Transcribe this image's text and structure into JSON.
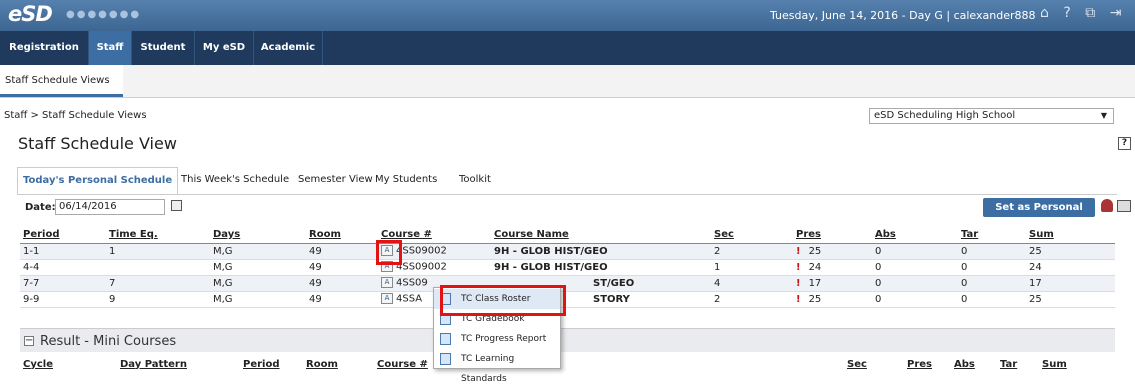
{
  "header": {
    "logo": "eSD",
    "dots": "●●●●●●●",
    "date_user": "Tuesday, June 14, 2016 - Day G  |  calexander888",
    "icons": [
      "home-icon",
      "help-icon",
      "window-icon",
      "logout-icon"
    ]
  },
  "nav": {
    "items": [
      "Registration",
      "Staff",
      "Student",
      "My eSD",
      "Academic"
    ],
    "active": "Staff"
  },
  "subnav": {
    "label": "Staff Schedule Views"
  },
  "breadcrumb": "Staff > Staff Schedule Views",
  "school_select": "eSD Scheduling High School",
  "page_title": "Staff Schedule View",
  "tabs": [
    "Today's Personal Schedule",
    "This Week's Schedule",
    "Semester View",
    "My Students",
    "Toolkit"
  ],
  "date_label": "Date:",
  "date_value": "06/14/2016",
  "set_personal_button": "Set as Personal Page",
  "schedule": {
    "columns": [
      "Period",
      "Time Eq.",
      "Days",
      "Room",
      "Course #",
      "Course Name",
      "Sec",
      "Pres",
      "Abs",
      "Tar",
      "Sum"
    ],
    "rows": [
      {
        "period": "1-1",
        "time": "1",
        "days": "M,G",
        "room": "49",
        "course": "4SS09002",
        "name": "9H - GLOB HIST/GEO",
        "sec": "2",
        "pres": "25",
        "abs": "0",
        "tar": "0",
        "sum": "25"
      },
      {
        "period": "4-4",
        "time": "",
        "days": "M,G",
        "room": "49",
        "course": "4SS09002",
        "name": "9H - GLOB HIST/GEO",
        "sec": "1",
        "pres": "24",
        "abs": "0",
        "tar": "0",
        "sum": "24"
      },
      {
        "period": "7-7",
        "time": "7",
        "days": "M,G",
        "room": "49",
        "course": "4SS09",
        "name": "ST/GEO",
        "sec": "4",
        "pres": "17",
        "abs": "0",
        "tar": "0",
        "sum": "17"
      },
      {
        "period": "9-9",
        "time": "9",
        "days": "M,G",
        "room": "49",
        "course": "4SSA",
        "name": "STORY",
        "sec": "2",
        "pres": "25",
        "abs": "0",
        "tar": "0",
        "sum": "25"
      }
    ]
  },
  "mini_courses": {
    "title": "Result - Mini Courses",
    "toggle": "−",
    "columns": [
      "Cycle",
      "Day Pattern",
      "Period",
      "Room",
      "Course #",
      "Sec",
      "Pres",
      "Abs",
      "Tar",
      "Sum"
    ]
  },
  "context_menu": {
    "items": [
      "TC Class Roster",
      "TC Gradebook",
      "TC Progress Report",
      "TC Learning Standards"
    ]
  },
  "colors": {
    "brand": "#3c6ea3",
    "navbar": "#1f3a5c",
    "highlight": "#e21313"
  }
}
